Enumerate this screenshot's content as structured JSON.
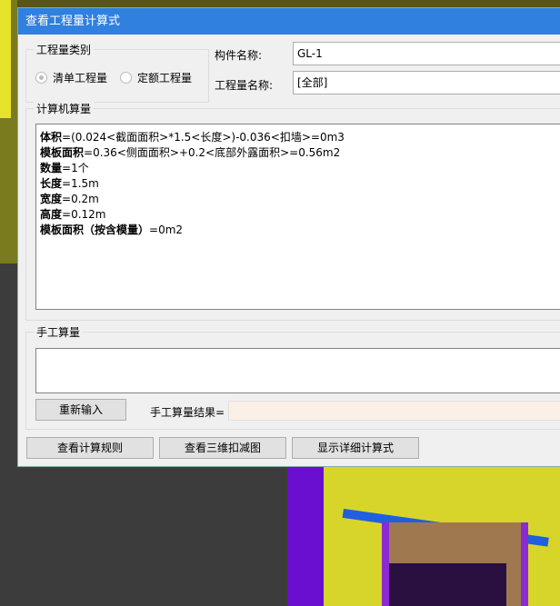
{
  "dialog": {
    "title": "查看工程量计算式"
  },
  "category": {
    "label": "工程量类别",
    "options": [
      {
        "label": "清单工程量",
        "selected": true
      },
      {
        "label": "定额工程量",
        "selected": false
      }
    ]
  },
  "component_name": {
    "label": "构件名称:",
    "value": "GL-1"
  },
  "quantity_name": {
    "label": "工程量名称:",
    "value": "[全部]"
  },
  "computer": {
    "label": "计算机算量",
    "lines": [
      {
        "name": "体积",
        "expr": "=(0.024<截面面积>*1.5<长度>)-0.036<扣墙>=0m3"
      },
      {
        "name": "模板面积",
        "expr": "=0.36<侧面面积>+0.2<底部外露面积>=0.56m2"
      },
      {
        "name": "数量",
        "expr": "=1个"
      },
      {
        "name": "长度",
        "expr": "=1.5m"
      },
      {
        "name": "宽度",
        "expr": "=0.2m"
      },
      {
        "name": "高度",
        "expr": "=0.12m"
      },
      {
        "name": "模板面积（按含模量）",
        "expr": "=0m2"
      }
    ]
  },
  "manual": {
    "label": "手工算量",
    "reinput_button": "重新输入",
    "result_label": "手工算量结果=",
    "result_value": ""
  },
  "buttons": {
    "view_rules": "查看计算规则",
    "view_3d": "查看三维扣减图",
    "show_detail": "显示详细计算式"
  }
}
